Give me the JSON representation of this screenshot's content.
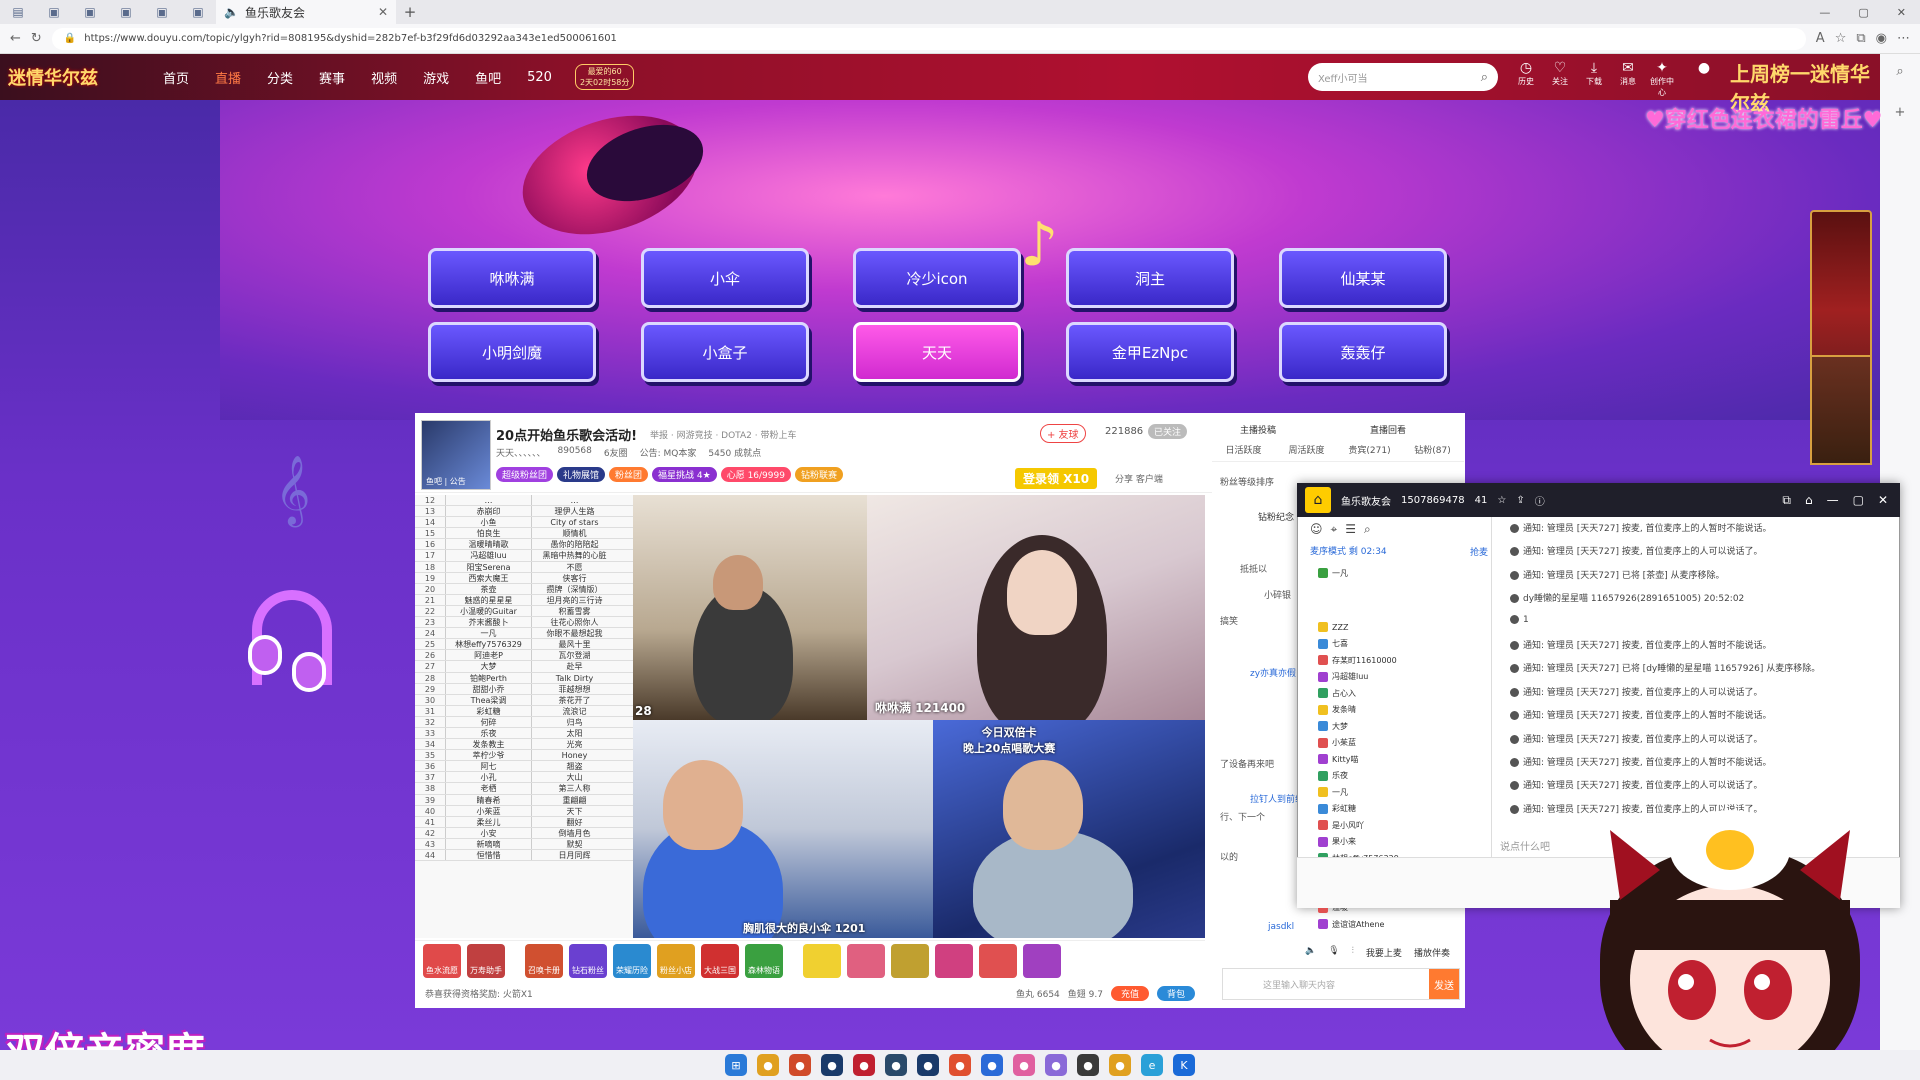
{
  "browser": {
    "tab_title": "鱼乐歌友会",
    "url": "https://www.douyu.com/topic/ylgyh?rid=808195&dyshid=282b7ef-b3f29fd6d03292aa343e1ed500061601"
  },
  "header": {
    "logo": "迷情华尔兹",
    "nav": [
      "首页",
      "直播",
      "分类",
      "赛事",
      "视频",
      "游戏",
      "鱼吧",
      "520"
    ],
    "promo": "最爱的60\n2天02时58分",
    "search_placeholder": "Xeff小可当",
    "icons": [
      {
        "name": "history-icon",
        "label": "历史"
      },
      {
        "name": "follow-icon",
        "label": "关注"
      },
      {
        "name": "download-icon",
        "label": "下载"
      },
      {
        "name": "message-icon",
        "label": "消息"
      },
      {
        "name": "creator-icon",
        "label": "创作中心"
      }
    ],
    "rank_text": "上周榜一迷情华尔兹"
  },
  "overlay_text": {
    "pink": "♥穿红色连衣裙的雷丘♥",
    "big": "双倍亲密度"
  },
  "singers": [
    "咻咻满",
    "小伞",
    "冷少icon",
    "洞主",
    "仙某某",
    "小明剑魔",
    "小盒子",
    "天天",
    "金甲EzNpc",
    "轰轰仔"
  ],
  "active_singer": "天天",
  "stream": {
    "title": "20点开始鱼乐歌会活动!",
    "crumbs": "举报 · 网游竞技 · DOTA2 · 带粉上车",
    "streamer": "天天、、、、、、",
    "hot": "890568",
    "fans": "6友圈",
    "notice": "公告: MQ本家",
    "followers_label": "5450 成就点",
    "follow_label": "+ 友球",
    "follow_count": "221886",
    "follow_status": "已关注",
    "tags": [
      "超级粉丝团",
      "礼物展馆",
      "粉丝团",
      "福星挑战 4★",
      "心愿 16/9999",
      "钻粉联赛"
    ],
    "signin": "登录领 X10",
    "share": "分享  客户端",
    "avatar_caption": "鱼吧 | 公告"
  },
  "playlist": [
    {
      "n": "12",
      "a": "…",
      "b": "…"
    },
    {
      "n": "13",
      "a": "赤崩印",
      "b": "理伊人生路"
    },
    {
      "n": "14",
      "a": "小鱼",
      "b": "City of stars"
    },
    {
      "n": "15",
      "a": "怕良生",
      "b": "顺情机"
    },
    {
      "n": "16",
      "a": "温暖晴晴歌",
      "b": "愚你的陪陪起"
    },
    {
      "n": "17",
      "a": "冯超雄luu",
      "b": "黑暗中热舞的心脏"
    },
    {
      "n": "18",
      "a": "阳宝Serena",
      "b": "不愿"
    },
    {
      "n": "19",
      "a": "西索大魔王",
      "b": "侠客行"
    },
    {
      "n": "20",
      "a": "茶壶",
      "b": "攒牌（深情版）"
    },
    {
      "n": "21",
      "a": "魅惑的星星星",
      "b": "坦月亮的三行诗"
    },
    {
      "n": "22",
      "a": "小温暖的Guitar",
      "b": "积蓄雪雾"
    },
    {
      "n": "23",
      "a": "芥末酱酸卜",
      "b": "往花心照你人"
    },
    {
      "n": "24",
      "a": "一凡",
      "b": "你眼不最想起我"
    },
    {
      "n": "25",
      "a": "林想effy7576329",
      "b": "最风十里"
    },
    {
      "n": "26",
      "a": "阿迪老P",
      "b": "瓦尔登湖"
    },
    {
      "n": "27",
      "a": "大梦",
      "b": "赴早"
    },
    {
      "n": "28",
      "a": "铂鲍Perth",
      "b": "Talk Dirty"
    },
    {
      "n": "29",
      "a": "甜甜小乔",
      "b": "菲越想想"
    },
    {
      "n": "30",
      "a": "Thea梁调",
      "b": "茶花开了"
    },
    {
      "n": "31",
      "a": "彩虹糖",
      "b": "流浪记"
    },
    {
      "n": "32",
      "a": "何碎",
      "b": "归鸟"
    },
    {
      "n": "33",
      "a": "乐夜",
      "b": "太阳"
    },
    {
      "n": "34",
      "a": "发条教主",
      "b": "光亮"
    },
    {
      "n": "35",
      "a": "萃柠少爷",
      "b": "Honey"
    },
    {
      "n": "36",
      "a": "阿七",
      "b": "翘盗"
    },
    {
      "n": "37",
      "a": "小孔",
      "b": "大山"
    },
    {
      "n": "38",
      "a": "老栖",
      "b": "第三人称"
    },
    {
      "n": "39",
      "a": "睛春希",
      "b": "重翩翩"
    },
    {
      "n": "40",
      "a": "小茱蓝",
      "b": "天下"
    },
    {
      "n": "41",
      "a": "柔丝儿",
      "b": "翻好"
    },
    {
      "n": "42",
      "a": "小安",
      "b": "倒墙月色"
    },
    {
      "n": "43",
      "a": "新嘀嘀",
      "b": "默契"
    },
    {
      "n": "44",
      "a": "恒惜惜",
      "b": "日月同辉"
    }
  ],
  "cams": {
    "cam1_label": "28",
    "cam2_label": "咻咻满 121400",
    "cam3_label": "胸肌很大的良小伞 1201",
    "cam4_text": "今日双倍卡\n晚上20点唱歌大赛"
  },
  "gifts": [
    "鱼水流愿",
    "万寿助手",
    "召唤卡册",
    "钻石粉丝",
    "荣耀历险",
    "粉丝小店",
    "大战三国",
    "森林物语"
  ],
  "footer": {
    "tip": "恭喜获得资格奖励: 火箭X1",
    "fish_balls": "鱼丸 6654",
    "fish_wings": "鱼翅 9.7",
    "recharge": "充值",
    "backpack": "背包"
  },
  "right_chat": {
    "top": [
      "主播投稿",
      "直播回看"
    ],
    "tabs": [
      "日活跃度",
      "周活跃度",
      "贵宾(271)",
      "钻粉(87)"
    ],
    "lines": [
      "粉丝等级排序",
      "钻粉纪念",
      "抵抵以",
      "小碎银",
      "搞笑",
      "zy亦真亦假",
      "了设备再来吧",
      "拉钉人到前线",
      "行、下一个",
      "以的",
      "jasdkl"
    ],
    "input_placeholder": "这里输入聊天内容",
    "send": "发送"
  },
  "app": {
    "title": "鱼乐歌友会",
    "room_id": "1507869478",
    "count": "41",
    "mode": "麦序模式 剩 02:34",
    "grab": "抢麦",
    "seat": "一凡",
    "queue": [
      "ZZZ",
      "七喜",
      "存某町11610000",
      "冯超雄luu",
      "占心入",
      "发条晴",
      "大梦",
      "小茱蓝",
      "Kitty喵",
      "乐夜",
      "一凡",
      "彩虹糖",
      "是小风吖",
      "果小来",
      "林想effy7576329",
      "柔丝儿",
      "阿谊老P",
      "温暖",
      "途谊谊Athene"
    ],
    "logs": [
      "通知: 管理员 [天天727] 按麦, 首位麦序上的人暂时不能说话。",
      "通知: 管理员 [天天727] 按麦, 首位麦序上的人可以说话了。",
      "通知: 管理员 [天天727] 已将 [茶壶] 从麦序移除。",
      "dy睡懒的星星喵 11657926(2891651005) 20:52:02",
      "1",
      "通知: 管理员 [天天727] 按麦, 首位麦序上的人暂时不能说话。",
      "通知: 管理员 [天天727] 已将 [dy睡懒的星星喵 11657926] 从麦序移除。",
      "通知: 管理员 [天天727] 按麦, 首位麦序上的人可以说话了。",
      "通知: 管理员 [天天727] 按麦, 首位麦序上的人暂时不能说话。",
      "通知: 管理员 [天天727] 按麦, 首位麦序上的人可以说话了。",
      "通知: 管理员 [天天727] 按麦, 首位麦序上的人暂时不能说话。",
      "通知: 管理员 [天天727] 按麦, 首位麦序上的人可以说话了。",
      "通知: 管理员 [天天727] 按麦, 首位麦序上的人可以说话了。"
    ],
    "input_placeholder": "说点什么吧",
    "bottom_tools": [
      "我要上麦",
      "播放伴奏"
    ]
  }
}
